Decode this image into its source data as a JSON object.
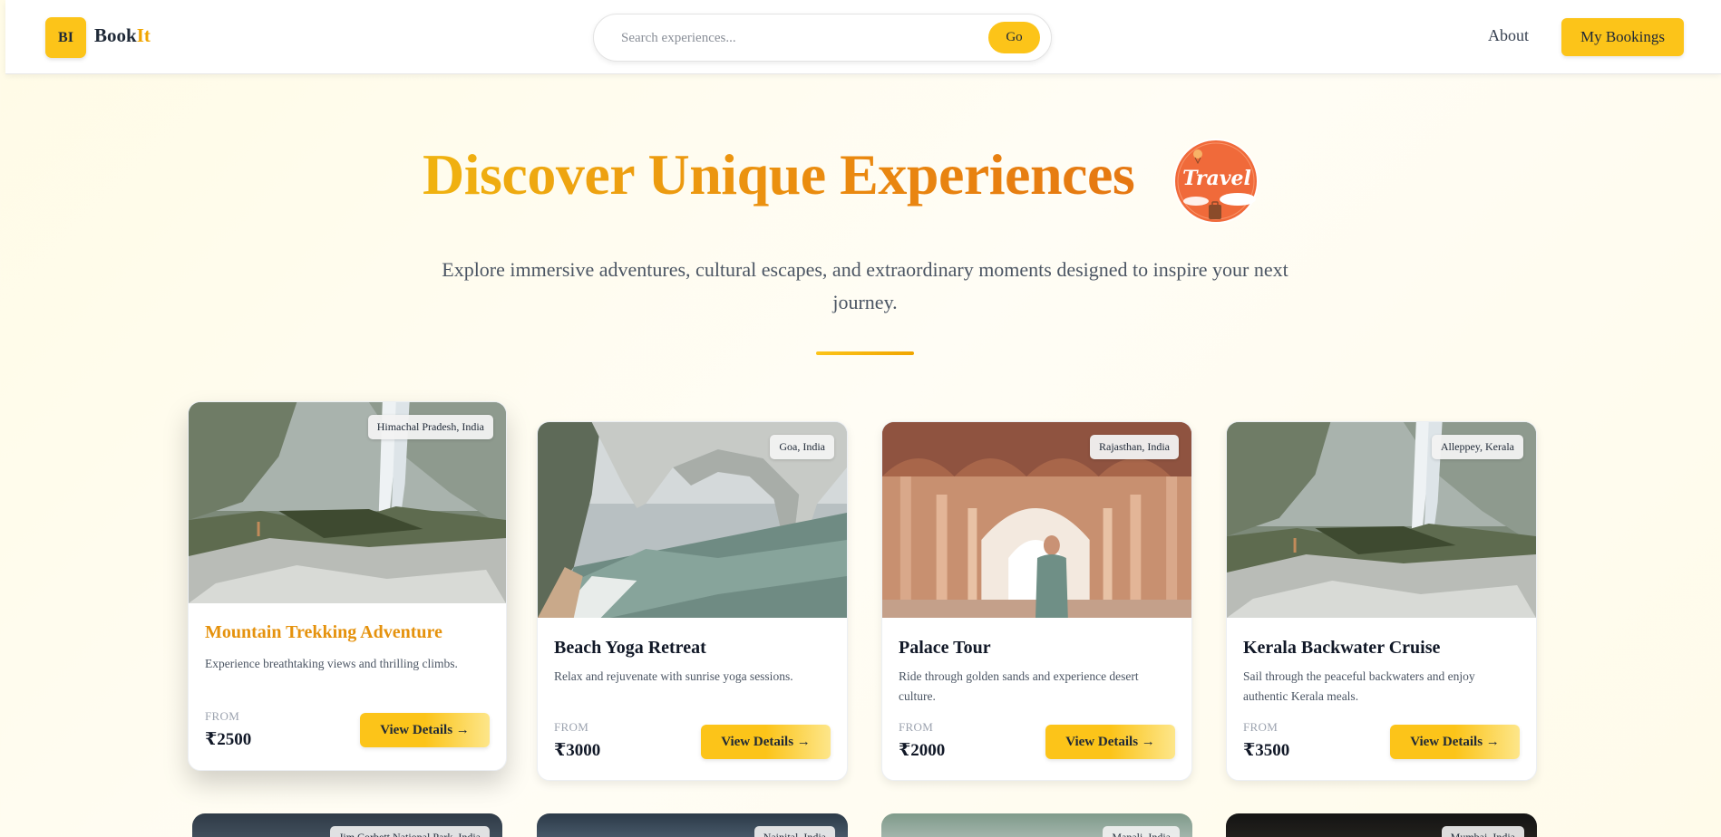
{
  "header": {
    "logo_initials": "BI",
    "brand_main": "Book",
    "brand_accent": "It",
    "search_placeholder": "Search experiences...",
    "search_button": "Go",
    "nav_about": "About",
    "bookings_button": "My Bookings"
  },
  "hero": {
    "title": "Discover Unique Experiences",
    "badge_text": "Travel",
    "subtitle": "Explore immersive adventures, cultural escapes, and extraordinary moments designed to inspire your next journey."
  },
  "cards": [
    {
      "title": "Mountain Trekking Adventure",
      "location": "Himachal Pradesh, India",
      "description": "Experience breathtaking views and thrilling climbs.",
      "from_label": "FROM",
      "price": "₹2500",
      "button": "View Details →",
      "image": "waterfall-cliff"
    },
    {
      "title": "Beach Yoga Retreat",
      "location": "Goa, India",
      "description": "Relax and rejuvenate with sunrise yoga sessions.",
      "from_label": "FROM",
      "price": "₹3000",
      "button": "View Details →",
      "image": "sea-arch"
    },
    {
      "title": "Palace Tour",
      "location": "Rajasthan, India",
      "description": "Ride through golden sands and experience desert culture.",
      "from_label": "FROM",
      "price": "₹2000",
      "button": "View Details →",
      "image": "palace-arches"
    },
    {
      "title": "Kerala Backwater Cruise",
      "location": "Alleppey, Kerala",
      "description": "Sail through the peaceful backwaters and enjoy authentic Kerala meals.",
      "from_label": "FROM",
      "price": "₹3500",
      "button": "View Details →",
      "image": "waterfall-cliff"
    }
  ],
  "peek_cards": [
    {
      "location": "Jim Corbett National Park, India"
    },
    {
      "location": "Nainital, India"
    },
    {
      "location": "Manali, India"
    },
    {
      "location": "Mumbai, India"
    }
  ],
  "colors": {
    "accent": "#fcc419",
    "title_gradient_start": "#f0b310",
    "title_gradient_end": "#e57612",
    "highlight_title": "#e5920d"
  }
}
